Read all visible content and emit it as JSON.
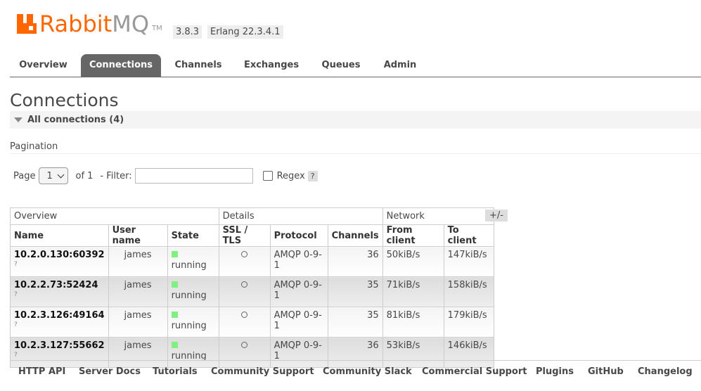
{
  "header": {
    "logo_rabbit": "Rabbit",
    "logo_mq": "MQ",
    "logo_tm": "TM",
    "version": "3.8.3",
    "erlang": "Erlang 22.3.4.1"
  },
  "tabs": [
    "Overview",
    "Connections",
    "Channels",
    "Exchanges",
    "Queues",
    "Admin"
  ],
  "active_tab": "Connections",
  "page_title": "Connections",
  "section": {
    "label": "All connections (4)"
  },
  "pagination": {
    "label": "Pagination",
    "page_label": "Page",
    "page_value": "1",
    "of_label": "of 1",
    "filter_label": "- Filter:",
    "filter_value": "",
    "regex_label": "Regex",
    "help": "?"
  },
  "table": {
    "groups": [
      "Overview",
      "Details",
      "Network"
    ],
    "columns": [
      "Name",
      "User name",
      "State",
      "SSL / TLS",
      "Protocol",
      "Channels",
      "From client",
      "To client"
    ],
    "toggle": "+/-",
    "rows": [
      {
        "name": "10.2.0.130:60392",
        "q": "?",
        "user": "james",
        "state": "running",
        "protocol": "AMQP 0-9-1",
        "channels": "36",
        "from": "50kiB/s",
        "to": "147kiB/s"
      },
      {
        "name": "10.2.2.73:52424",
        "q": "?",
        "user": "james",
        "state": "running",
        "protocol": "AMQP 0-9-1",
        "channels": "35",
        "from": "71kiB/s",
        "to": "158kiB/s"
      },
      {
        "name": "10.2.3.126:49164",
        "q": "?",
        "user": "james",
        "state": "running",
        "protocol": "AMQP 0-9-1",
        "channels": "35",
        "from": "81kiB/s",
        "to": "179kiB/s"
      },
      {
        "name": "10.2.3.127:55662",
        "q": "?",
        "user": "james",
        "state": "running",
        "protocol": "AMQP 0-9-1",
        "channels": "36",
        "from": "53kiB/s",
        "to": "146kiB/s"
      }
    ]
  },
  "footer": [
    "HTTP API",
    "Server Docs",
    "Tutorials",
    "Community Support",
    "Community Slack",
    "Commercial Support",
    "Plugins",
    "GitHub",
    "Changelog"
  ],
  "colors": {
    "brand": "#ff6600",
    "state_running": "#80f080",
    "tab_active": "#666666"
  }
}
